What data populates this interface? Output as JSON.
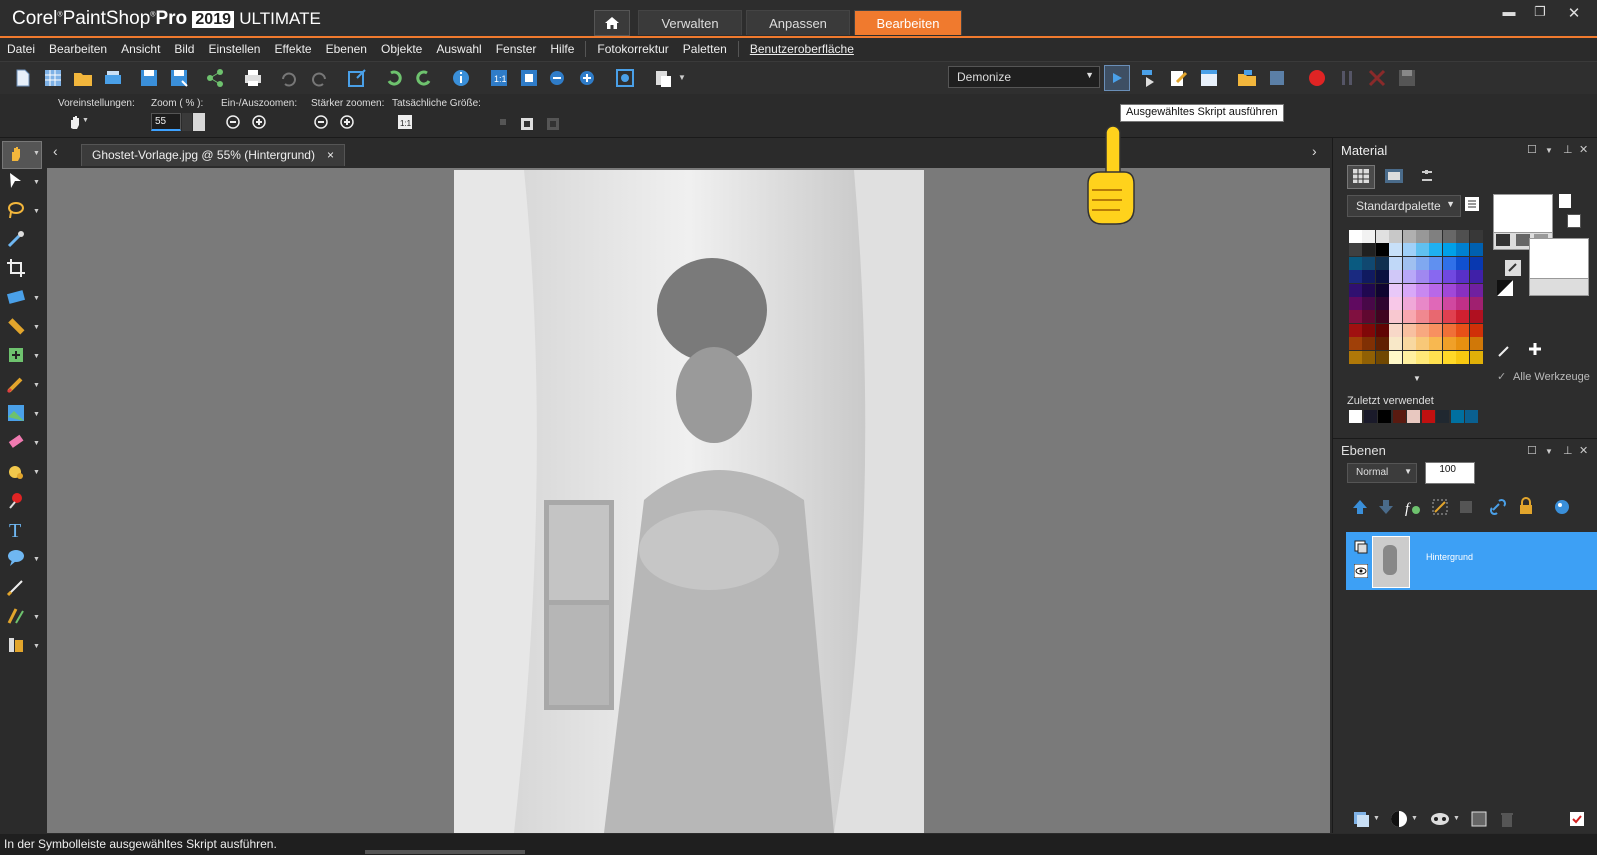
{
  "app": {
    "brand": "Corel",
    "product": "PaintShop",
    "pro": "Pro",
    "version": "2019",
    "edition": "ULTIMATE"
  },
  "workspace_tabs": [
    {
      "label": "Verwalten",
      "active": false
    },
    {
      "label": "Anpassen",
      "active": false
    },
    {
      "label": "Bearbeiten",
      "active": true
    }
  ],
  "menu": [
    "Datei",
    "Bearbeiten",
    "Ansicht",
    "Bild",
    "Einstellen",
    "Effekte",
    "Ebenen",
    "Objekte",
    "Auswahl",
    "Fenster",
    "Hilfe",
    "Fotokorrektur",
    "Paletten",
    "Benutzeroberfläche"
  ],
  "toolbar": {
    "script_name": "Demonize",
    "tooltip": "Ausgewähltes Skript ausführen"
  },
  "options": {
    "presets_label": "Voreinstellungen:",
    "zoom_label": "Zoom ( % ):",
    "zoom_value": "55",
    "inout_label": "Ein-/Auszoomen:",
    "more_label": "Stärker zoomen:",
    "actual_label": "Tatsächliche Größe:"
  },
  "document": {
    "tab_title": "Ghostet-Vorlage.jpg @  55% (Hintergrund)",
    "close": "×"
  },
  "material": {
    "title": "Material",
    "palette_name": "Standardpalette",
    "recent_label": "Zuletzt verwendet",
    "all_tools_label": "Alle Werkzeuge",
    "recent_colors": [
      "#ffffff",
      "#1a1a2a",
      "#000000",
      "#5a1a10",
      "#e8c8c0",
      "#c01010",
      "#202830",
      "#0070a0",
      "#0a6090"
    ]
  },
  "layers": {
    "title": "Ebenen",
    "blend_mode": "Normal",
    "opacity": "100",
    "items": [
      {
        "name": "Hintergrund"
      }
    ]
  },
  "status": {
    "text": "In der Symbolleiste ausgewähltes Skript ausführen."
  },
  "colors": {
    "accent": "#f07a2e",
    "selection": "#3da0f5"
  }
}
